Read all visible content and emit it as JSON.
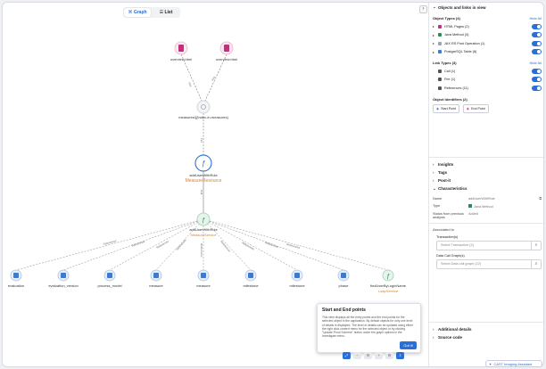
{
  "toolbar": {
    "graph_label": "Graph",
    "list_label": "List"
  },
  "graph": {
    "top_nodes": [
      {
        "label": "overview.html"
      },
      {
        "label": "overview.html"
      }
    ],
    "url_node": {
      "label": "measures/{{index-in-measures}"
    },
    "method_node": {
      "label": "addUserWithRole",
      "sub": "MeasureResource"
    },
    "service_node": {
      "label": "addUserWithRole",
      "sub": "MeasureService"
    },
    "table_nodes": [
      {
        "label": "evaluation"
      },
      {
        "label": "evaluation_version"
      },
      {
        "label": "process_model"
      },
      {
        "label": "measure"
      },
      {
        "label": "measure"
      },
      {
        "label": "milestone"
      },
      {
        "label": "milestone"
      },
      {
        "label": "phase"
      },
      {
        "label": "findUserByLoginName",
        "sub": "LdapService"
      }
    ],
    "edge_labels": {
      "call": "Call",
      "fire": "Fire",
      "references": "References"
    }
  },
  "popup": {
    "title": "Start and End points",
    "body": "This view displays all the entry points and the end points for the selected object in the application. By default objects for only one level of details is displayed. The level of details can be updated using either the right click context menu for the selected object or by clicking \"Update Proof Scheme\" button under the graph options in the investigate menu.",
    "button": "Got it!"
  },
  "panel": {
    "objects_links_title": "Objects and links in view",
    "object_types_title": "Object Types (4)",
    "hide_all": "Hide All",
    "object_types": [
      {
        "label": "HTML Pages (2)",
        "color": "#c1307a"
      },
      {
        "label": "Java Method (3)",
        "color": "#2e8b57"
      },
      {
        "label": "JAX RS Post Operation (1)",
        "color": "#9aa4b1"
      },
      {
        "label": "PostgreSQL Table (8)",
        "color": "#3a7bd5"
      }
    ],
    "link_types_title": "Link Types (3)",
    "link_types": [
      {
        "label": "Call (1)"
      },
      {
        "label": "Fire (1)"
      },
      {
        "label": "References (11)"
      }
    ],
    "identifiers_title": "Object Identifiers (2)",
    "start_point": "Start Point",
    "end_point": "End Point",
    "sections": {
      "insights": "Insights",
      "tags": "Tags",
      "postit": "Post-it",
      "characteristics": "Characteristics",
      "additional": "Additional details",
      "source": "Source code"
    },
    "char": {
      "name_k": "Name",
      "name_v": "addUserWithRole",
      "type_k": "Type",
      "type_v": "Java Method",
      "status_k": "Status from previous analysis",
      "status_v": "Added"
    },
    "associated": "Associated to",
    "transactions_label": "Transaction(s)",
    "transactions_placeholder": "Select Transaction (2)",
    "datacall_label": "Data Call Graph(s)",
    "datacall_placeholder": "Select Data call graph (22)",
    "assistant": "CAST Imaging Assistant"
  }
}
